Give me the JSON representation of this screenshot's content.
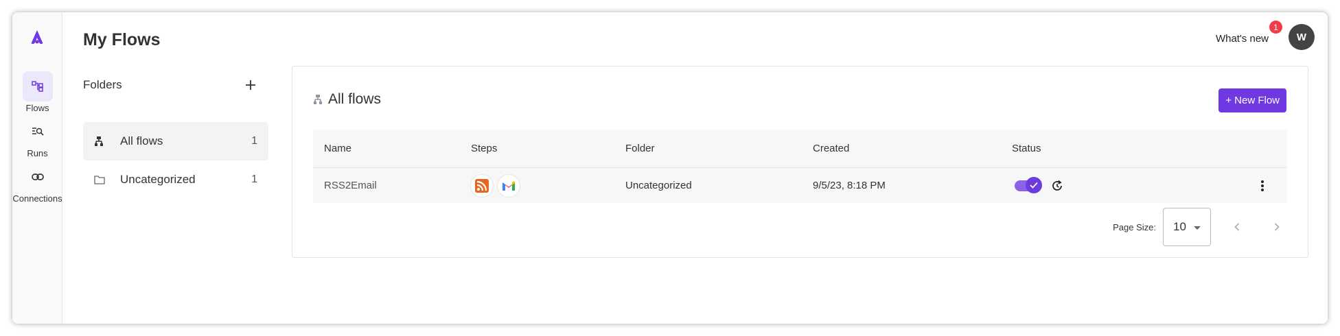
{
  "nav": {
    "items": [
      {
        "label": "Flows",
        "icon": "flows-icon",
        "active": true
      },
      {
        "label": "Runs",
        "icon": "runs-icon",
        "active": false
      },
      {
        "label": "Connections",
        "icon": "link-icon",
        "active": false
      }
    ]
  },
  "header": {
    "title": "My Flows",
    "whats_new": "What's new",
    "notification_count": "1",
    "avatar_initial": "W"
  },
  "folders": {
    "title": "Folders",
    "items": [
      {
        "label": "All flows",
        "count": "1",
        "active": true
      },
      {
        "label": "Uncategorized",
        "count": "1",
        "active": false
      }
    ]
  },
  "panel": {
    "title": "All flows",
    "new_flow_label": "+ New Flow"
  },
  "table": {
    "columns": [
      "Name",
      "Steps",
      "Folder",
      "Created",
      "Status"
    ],
    "rows": [
      {
        "name": "RSS2Email",
        "steps": [
          "rss-icon",
          "gmail-icon"
        ],
        "folder": "Uncategorized",
        "created": "9/5/23, 8:18 PM",
        "enabled": true
      }
    ]
  },
  "pagination": {
    "page_size_label": "Page Size:",
    "page_size": "10"
  },
  "colors": {
    "accent": "#7038e0",
    "badge": "#ef3e4a"
  }
}
